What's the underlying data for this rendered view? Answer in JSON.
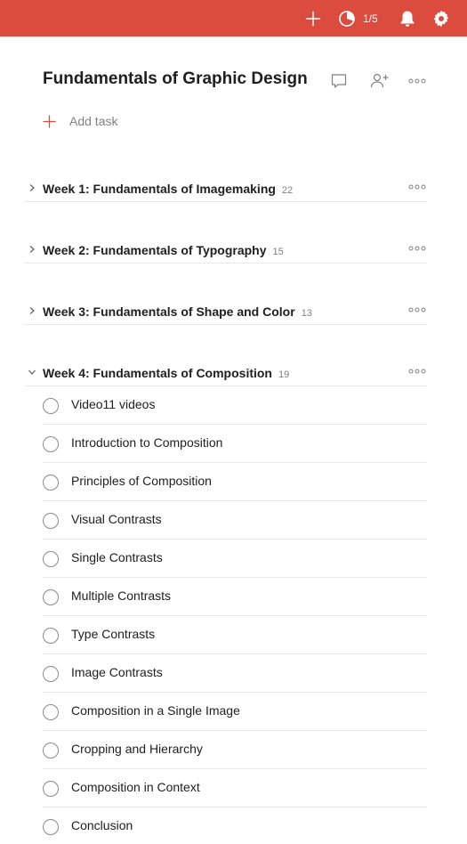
{
  "colors": {
    "brand": "#db4c3f",
    "text": "#202020",
    "muted": "#808080",
    "divider": "#e8e8e8"
  },
  "topbar": {
    "icons": [
      "plus-icon",
      "karma-icon",
      "bell-icon",
      "gear-icon"
    ],
    "karma_progress": "1/5"
  },
  "project": {
    "title": "Fundamentals of Graphic Design",
    "actions": [
      "comment-icon",
      "share-icon",
      "more-icon"
    ]
  },
  "add_task_label": "Add task",
  "sections": [
    {
      "name": "Week 1: Fundamentals of Imagemaking",
      "count": "22",
      "expanded": false
    },
    {
      "name": "Week 2: Fundamentals of Typography",
      "count": "15",
      "expanded": false
    },
    {
      "name": "Week 3: Fundamentals of Shape and Color",
      "count": "13",
      "expanded": false
    },
    {
      "name": "Week 4: Fundamentals of Composition",
      "count": "19",
      "expanded": true
    }
  ],
  "tasks": [
    "Video11 videos",
    "Introduction to Composition",
    "Principles of Composition",
    "Visual Contrasts",
    "Single Contrasts",
    "Multiple Contrasts",
    "Type Contrasts",
    "Image Contrasts",
    "Composition in a Single Image",
    "Cropping and Hierarchy",
    "Composition in Context",
    "Conclusion"
  ]
}
